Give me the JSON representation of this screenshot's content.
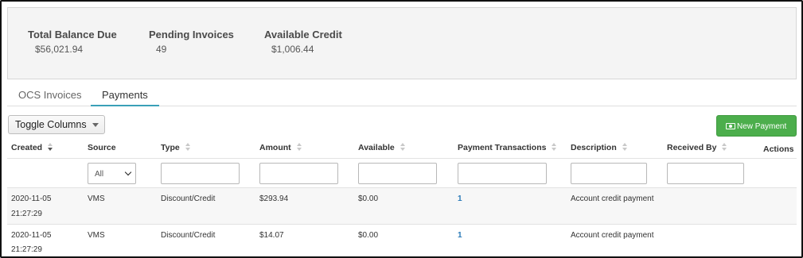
{
  "summary": {
    "total_balance_label": "Total Balance Due",
    "total_balance_value": "$56,021.94",
    "pending_invoices_label": "Pending Invoices",
    "pending_invoices_value": "49",
    "available_credit_label": "Available Credit",
    "available_credit_value": "$1,006.44"
  },
  "tabs": [
    {
      "label": "OCS Invoices",
      "active": false
    },
    {
      "label": "Payments",
      "active": true
    }
  ],
  "toolbar": {
    "toggle_columns_label": "Toggle Columns",
    "new_payment_label": "New Payment",
    "new_payment_icon": "money-icon",
    "new_payment_color": "#4cae4c"
  },
  "table": {
    "columns": [
      "Created",
      "Source",
      "Type",
      "Amount",
      "Available",
      "Payment Transactions",
      "Description",
      "Received By",
      "Actions"
    ],
    "source_filter_selected": "All",
    "rows": [
      {
        "created_date": "2020-11-05",
        "created_time": "21:27:29",
        "source": "VMS",
        "type": "Discount/Credit",
        "amount": "$293.94",
        "available": "$0.00",
        "transactions": "1",
        "description": "Account credit payment",
        "received_by": ""
      },
      {
        "created_date": "2020-11-05",
        "created_time": "21:27:29",
        "source": "VMS",
        "type": "Discount/Credit",
        "amount": "$14.07",
        "available": "$0.00",
        "transactions": "1",
        "description": "Account credit payment",
        "received_by": ""
      }
    ]
  },
  "colors": {
    "accent_tab_underline": "#3aa0b8",
    "link": "#2a7ab8"
  }
}
